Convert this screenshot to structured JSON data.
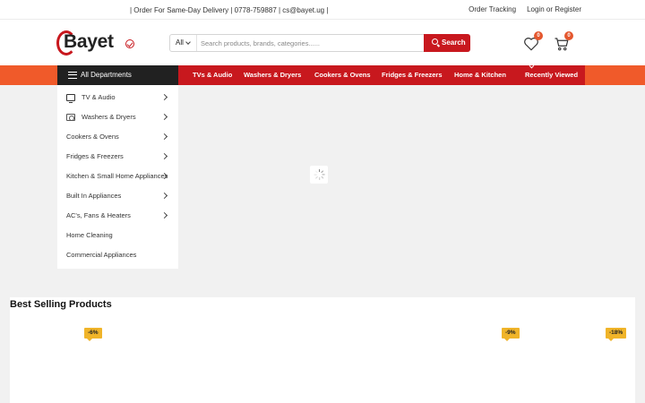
{
  "topbar": {
    "contact": "| Order For Same-Day Delivery | 0778-759887 | cs@bayet.ug |",
    "order_tracking": "Order Tracking",
    "login": "Login or Register"
  },
  "header": {
    "logo_text": "Bayet",
    "search": {
      "category": "All",
      "placeholder": "Search products, brands, categories......",
      "button_label": "Search"
    },
    "wishlist_count": "0",
    "cart_count": "0"
  },
  "nav": {
    "departments_label": "All Departments",
    "items": [
      "TVs & Audio",
      "Washers & Dryers",
      "Cookers & Ovens",
      "Fridges & Freezers",
      "Home & Kitchen"
    ],
    "recently_viewed": "Recently Viewed"
  },
  "departments": [
    {
      "label": "TV & Audio",
      "icon": "tv-icon",
      "has_sub": true
    },
    {
      "label": "Washers & Dryers",
      "icon": "washer-icon",
      "has_sub": true
    },
    {
      "label": "Cookers & Ovens",
      "icon": "",
      "has_sub": true
    },
    {
      "label": "Fridges & Freezers",
      "icon": "",
      "has_sub": true
    },
    {
      "label": "Kitchen & Small Home Appliances",
      "icon": "",
      "has_sub": true
    },
    {
      "label": "Built In Appliances",
      "icon": "",
      "has_sub": true
    },
    {
      "label": "AC's, Fans & Heaters",
      "icon": "",
      "has_sub": true
    },
    {
      "label": "Home Cleaning",
      "icon": "",
      "has_sub": false
    },
    {
      "label": "Commercial Appliances",
      "icon": "",
      "has_sub": false
    }
  ],
  "best_selling": {
    "title": "Best Selling Products",
    "discounts": [
      "-6%",
      "-9%",
      "-18%"
    ]
  },
  "colors": {
    "brand_red": "#c8181e",
    "nav_orange": "#f05a2a",
    "badge_orange": "#e4572e",
    "discount_yellow": "#f0b429"
  }
}
